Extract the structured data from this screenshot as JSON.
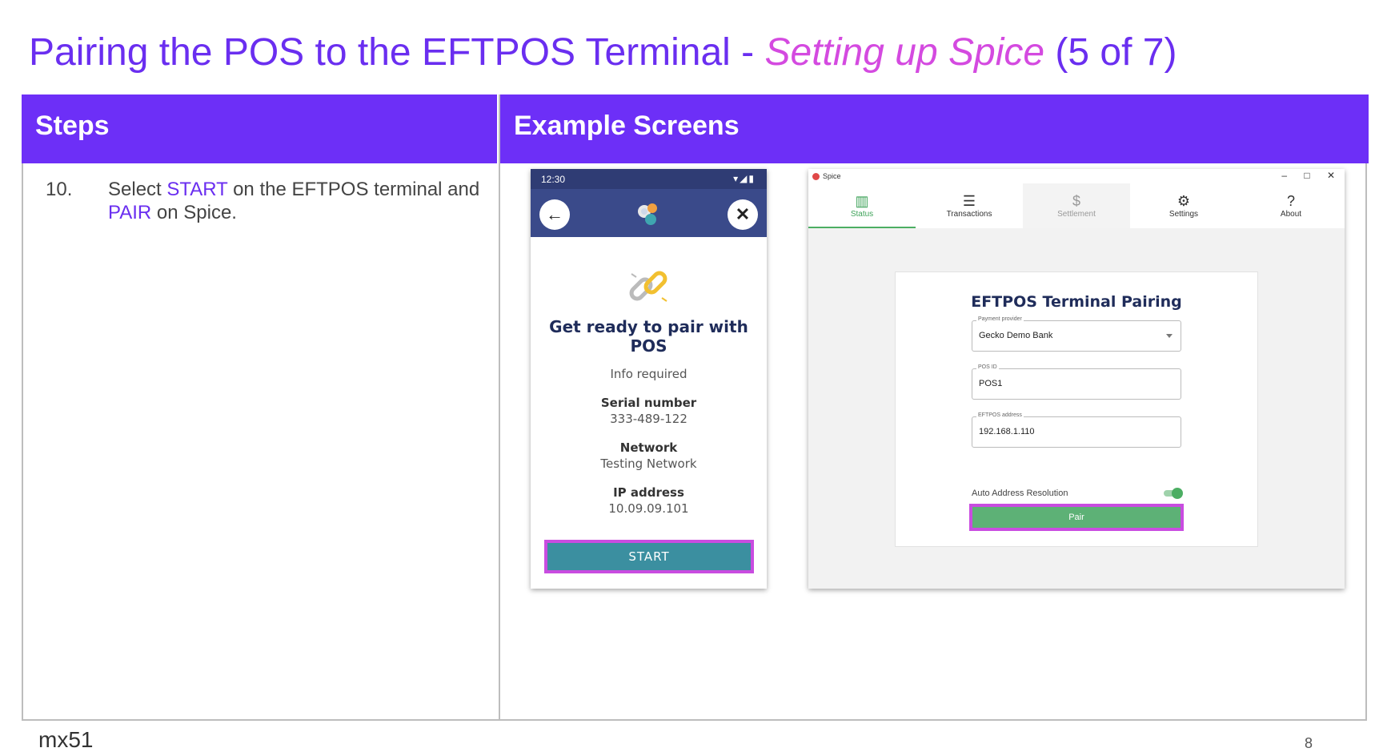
{
  "title": {
    "part1": "Pairing the POS to the EFTPOS Terminal - ",
    "accent": "Setting up Spice",
    "part2": " (5 of 7)"
  },
  "table": {
    "header_steps": "Steps",
    "header_screens": "Example Screens"
  },
  "step": {
    "number": "10.",
    "t1": "Select ",
    "h1": "START",
    "t2": " on the EFTPOS terminal and ",
    "h2": "PAIR",
    "t3": " on Spice."
  },
  "phone": {
    "time": "12:30",
    "status_icons": "▾◢▮",
    "back_icon": "←",
    "close_icon": "✕",
    "heading": "Get ready to pair with POS",
    "info": "Info required",
    "serial_label": "Serial number",
    "serial_value": "333-489-122",
    "network_label": "Network",
    "network_value": "Testing Network",
    "ip_label": "IP address",
    "ip_value": "10.09.09.101",
    "start_button": "START"
  },
  "desktop": {
    "app_name": "Spice",
    "win_buttons": [
      "–",
      "□",
      "✕"
    ],
    "tabs": [
      {
        "label": "Status",
        "icon": "▥",
        "icon_name": "chart-icon",
        "state": "active"
      },
      {
        "label": "Transactions",
        "icon": "☰",
        "icon_name": "list-icon",
        "state": "normal"
      },
      {
        "label": "Settlement",
        "icon": "$",
        "icon_name": "settlement-icon",
        "state": "dim"
      },
      {
        "label": "Settings",
        "icon": "⚙",
        "icon_name": "gear-icon",
        "state": "normal"
      },
      {
        "label": "About",
        "icon": "?",
        "icon_name": "help-icon",
        "state": "normal"
      }
    ],
    "card_title": "EFTPOS Terminal Pairing",
    "provider_label": "Payment provider",
    "provider_value": "Gecko Demo Bank",
    "posid_label": "POS ID",
    "posid_value": "POS1",
    "address_label": "EFTPOS address",
    "address_value": "192.168.1.110",
    "auto_label": "Auto Address Resolution",
    "pair_button": "Pair"
  },
  "footer": {
    "logo": "mx51",
    "page": "8"
  },
  "colors": {
    "brand_purple": "#6d2ff7",
    "accent_pink": "#d44ae0",
    "highlight_border": "#c94ce0",
    "start_teal": "#3b8fa0",
    "pair_green": "#5db176"
  }
}
